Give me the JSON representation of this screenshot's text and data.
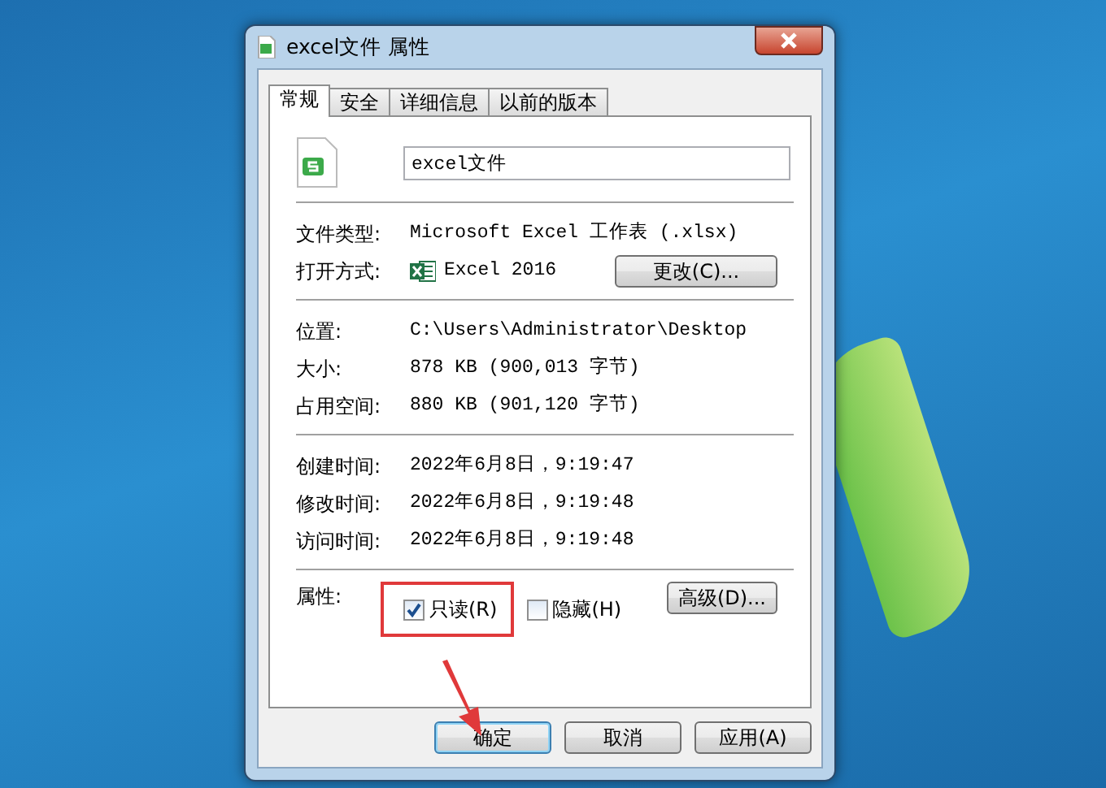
{
  "window": {
    "title": "excel文件 属性"
  },
  "tabs": [
    {
      "label": "常规",
      "selected": true
    },
    {
      "label": "安全",
      "selected": false
    },
    {
      "label": "详细信息",
      "selected": false
    },
    {
      "label": "以前的版本",
      "selected": false
    }
  ],
  "file_name": {
    "value": "excel文件"
  },
  "groups": [
    [
      {
        "label": "文件类型:",
        "value": "Microsoft Excel 工作表 (.xlsx)"
      },
      {
        "label": "打开方式:",
        "value": "Excel 2016",
        "kind": "app",
        "button": "更改(C)..."
      }
    ],
    [
      {
        "label": "位置:",
        "value": "C:\\Users\\Administrator\\Desktop"
      },
      {
        "label": "大小:",
        "value": "878 KB (900,013 字节)"
      },
      {
        "label": "占用空间:",
        "value": "880 KB (901,120 字节)"
      }
    ],
    [
      {
        "label": "创建时间:",
        "value": "2022年6月8日，9:19:47"
      },
      {
        "label": "修改时间:",
        "value": "2022年6月8日，9:19:48"
      },
      {
        "label": "访问时间:",
        "value": "2022年6月8日，9:19:48"
      }
    ]
  ],
  "attributes": {
    "label": "属性:",
    "checkboxes": [
      {
        "label": "只读(R)",
        "checked": true,
        "highlighted": true
      },
      {
        "label": "隐藏(H)",
        "checked": false,
        "highlighted": false
      }
    ],
    "button": "高级(D)..."
  },
  "buttons": [
    {
      "label": "确定",
      "default": true
    },
    {
      "label": "取消",
      "default": false
    },
    {
      "label": "应用(A)",
      "default": false
    }
  ]
}
